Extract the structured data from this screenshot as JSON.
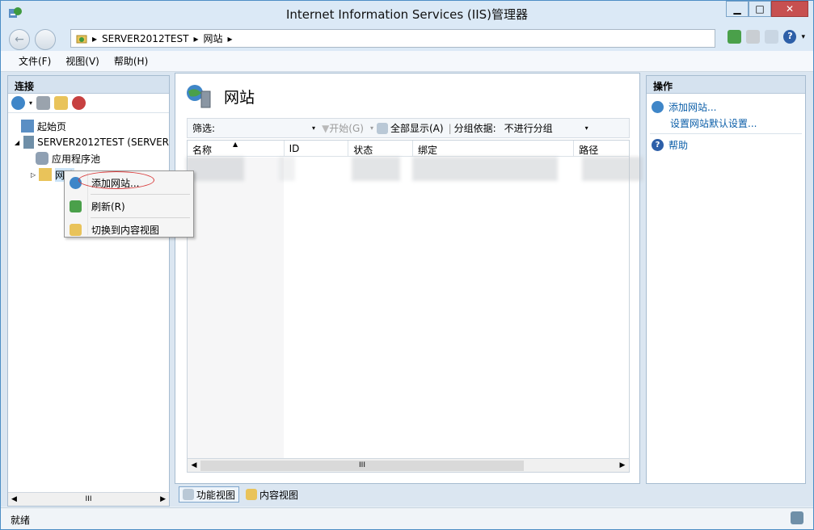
{
  "window": {
    "title": "Internet Information Services (IIS)管理器",
    "buttons": {
      "minimize": "▁",
      "maximize": "□",
      "close": "✕"
    }
  },
  "address": {
    "segments": [
      "SERVER2012TEST",
      "网站"
    ],
    "separator": "▸"
  },
  "menu": [
    "文件(F)",
    "视图(V)",
    "帮助(H)"
  ],
  "connections": {
    "header": "连接",
    "tree": [
      {
        "label": "起始页",
        "icon": "start-page-icon"
      },
      {
        "label": "SERVER2012TEST (SERVER",
        "icon": "server-icon"
      },
      {
        "label": "应用程序池",
        "icon": "app-pool-icon"
      },
      {
        "label": "网站",
        "icon": "sites-folder-icon"
      }
    ],
    "scroll_label": "III"
  },
  "center": {
    "title": "网站",
    "filter": {
      "label": "筛选:",
      "start": "开始(G)",
      "show_all": "全部显示(A)",
      "group_by_label": "分组依据:",
      "group_by_value": "不进行分组"
    },
    "columns": [
      "名称",
      "ID",
      "状态",
      "绑定",
      "路径"
    ],
    "scroll_label": "III"
  },
  "tabs": {
    "features": "功能视图",
    "content": "内容视图"
  },
  "actions": {
    "header": "操作",
    "add_site": "添加网站...",
    "site_defaults": "设置网站默认设置...",
    "help": "帮助"
  },
  "context_menu": [
    {
      "label": "添加网站...",
      "icon": "add-site-icon"
    },
    {
      "label": "刷新(R)",
      "icon": "refresh-icon"
    },
    {
      "label": "切换到内容视图",
      "icon": "content-view-icon"
    }
  ],
  "status": "就绪",
  "colors": {
    "link": "#0b5ea8",
    "header_bg": "#d5e2ef",
    "highlight": "#d83a3a"
  }
}
